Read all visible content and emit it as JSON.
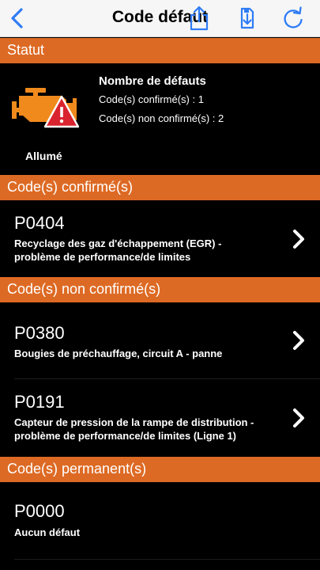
{
  "nav": {
    "title": "Code défaut",
    "back_icon": "chevron-left-icon",
    "share_icon": "share-icon",
    "save_icon": "save-download-icon",
    "refresh_icon": "refresh-icon",
    "accent": "#2f7cf6"
  },
  "sections": {
    "status": "Statut",
    "confirmed": "Code(s) confirmé(s)",
    "unconfirmed": "Code(s) non confirmé(s)",
    "permanent": "Code(s) permanent(s)"
  },
  "status": {
    "title": "Nombre de défauts",
    "confirmed_line": "Code(s) confirmé(s) : 1",
    "unconfirmed_line": "Code(s) non confirmé(s) : 2",
    "lamp_state": "Allumé",
    "engine_icon": "check-engine-warning-icon",
    "engine_color": "#f08a1d",
    "warning_color": "#d9232e"
  },
  "confirmed_codes": [
    {
      "code": "P0404",
      "desc_lines": [
        "Recyclage des gaz d'échappement (EGR) -",
        "problème de performance/de limites"
      ]
    }
  ],
  "unconfirmed_codes": [
    {
      "code": "P0380",
      "desc_lines": [
        "Bougies de préchauffage, circuit A - panne"
      ]
    },
    {
      "code": "P0191",
      "desc_lines": [
        "Capteur de pression de la rampe de distribution -",
        "problème de performance/de limites (Ligne 1)"
      ]
    }
  ],
  "permanent_codes": [
    {
      "code": "P0000",
      "desc_lines": [
        "Aucun défaut"
      ]
    }
  ],
  "colors": {
    "section_header": "#dd6a24",
    "background": "#000000"
  }
}
